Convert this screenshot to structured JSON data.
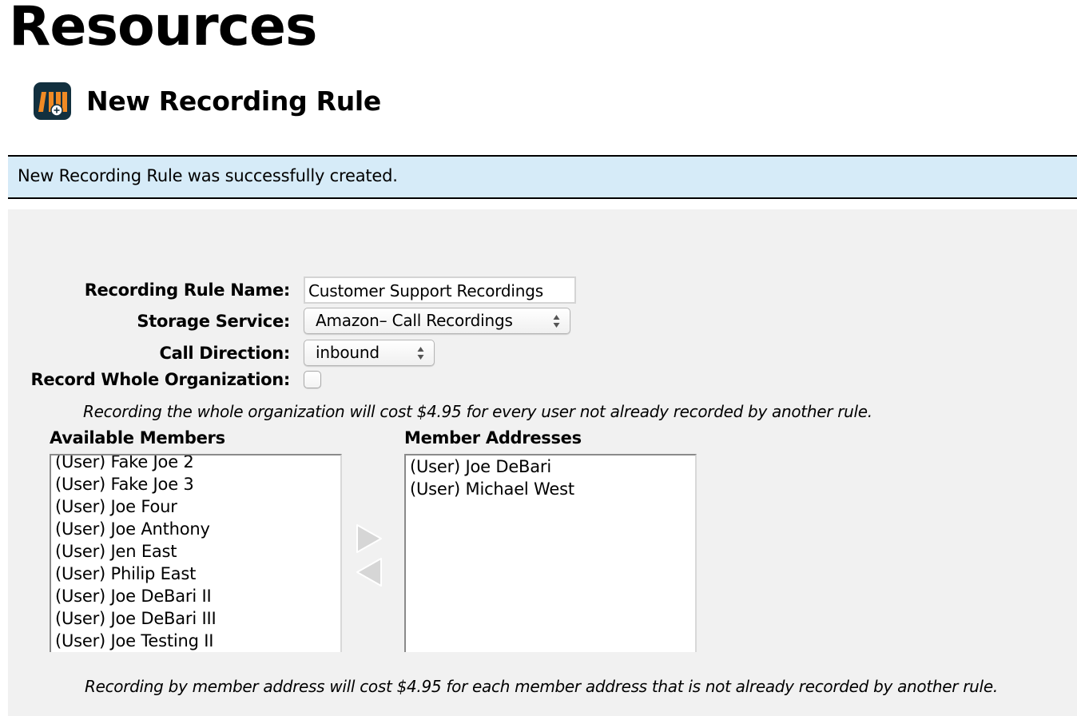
{
  "page": {
    "title": "Resources",
    "subtitle": "New Recording Rule",
    "icon": "recording-rule-icon"
  },
  "flash": {
    "message": "New Recording Rule was successfully created.",
    "background": "#d6ebf8"
  },
  "form": {
    "rule_name": {
      "label": "Recording Rule Name:",
      "value": "Customer Support Recordings"
    },
    "storage_service": {
      "label": "Storage Service:",
      "selected": "Amazon– Call Recordings"
    },
    "call_direction": {
      "label": "Call Direction:",
      "selected": "inbound"
    },
    "record_whole_org": {
      "label": "Record Whole Organization:",
      "checked": false
    },
    "whole_org_hint": "Recording the whole organization will cost $4.95 for every user not already recorded by another rule.",
    "available_members": {
      "heading": "Available Members",
      "items": [
        "(User) Fake Joe 2",
        "(User) Fake Joe 3",
        "(User) Joe Four",
        "(User) Joe Anthony",
        "(User) Jen East",
        "(User) Philip East",
        "(User) Joe DeBari II",
        "(User) Joe DeBari III",
        "(User) Joe Testing II"
      ]
    },
    "member_addresses": {
      "heading": "Member Addresses",
      "items": [
        "(User) Joe DeBari",
        "(User) Michael West"
      ]
    },
    "add_button": "move-right-arrow",
    "remove_button": "move-left-arrow",
    "member_hint": "Recording by member address will cost $4.95 for each member address that is not already recorded by another rule."
  },
  "colors": {
    "icon_background": "#12303f",
    "icon_accent": "#f08a24",
    "panel_background": "#f1f1f1"
  }
}
